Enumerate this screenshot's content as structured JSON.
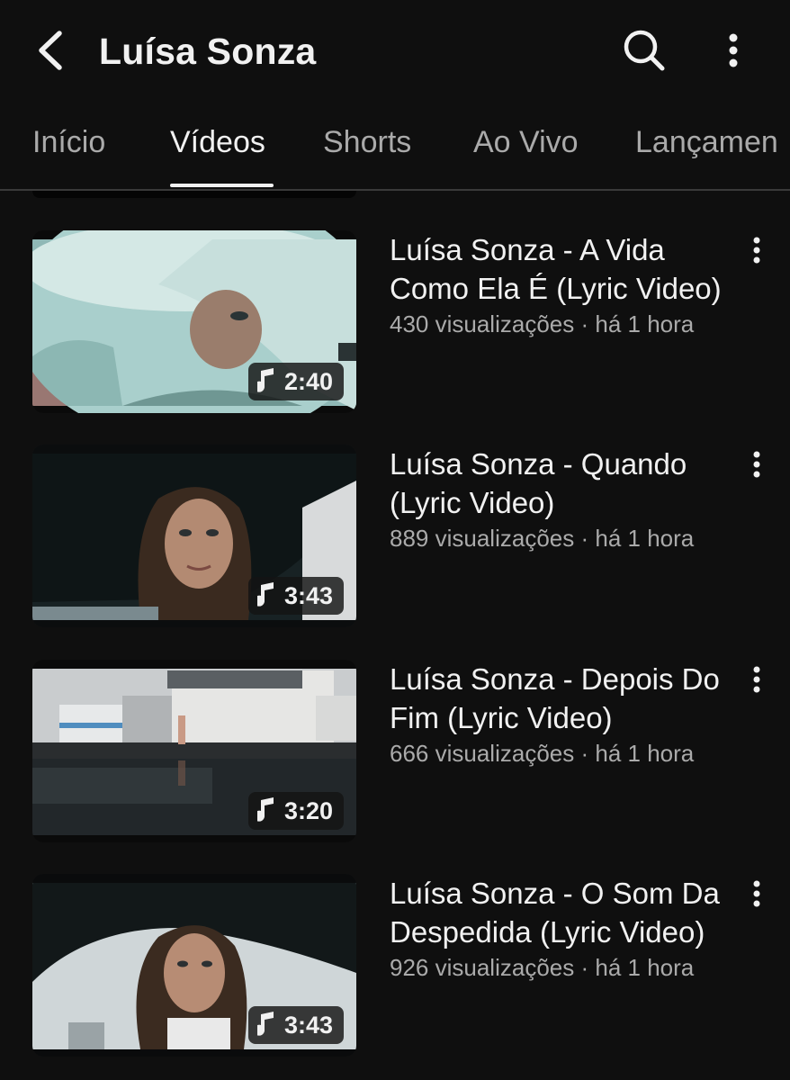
{
  "header": {
    "title": "Luísa Sonza",
    "back_icon": "chevron-left-icon",
    "search_icon": "search-icon",
    "more_icon": "more-vertical-icon"
  },
  "tabs": [
    {
      "label": "Início",
      "active": false
    },
    {
      "label": "Vídeos",
      "active": true
    },
    {
      "label": "Shorts",
      "active": false
    },
    {
      "label": "Ao Vivo",
      "active": false
    },
    {
      "label": "Lançamen",
      "active": false
    }
  ],
  "videos": [
    {
      "title": "Luísa Sonza - A Vida Como Ela É (Lyric Video)",
      "views": "430 visualizações",
      "age": "há 1 hora",
      "duration": "2:40",
      "duration_icon": "music-note-icon"
    },
    {
      "title": "Luísa Sonza - Quando (Lyric Video)",
      "views": "889 visualizações",
      "age": "há 1 hora",
      "duration": "3:43",
      "duration_icon": "music-note-icon"
    },
    {
      "title": "Luísa Sonza - Depois Do Fim (Lyric Video)",
      "views": "666 visualizações",
      "age": "há 1 hora",
      "duration": "3:20",
      "duration_icon": "music-note-icon"
    },
    {
      "title": "Luísa Sonza - O Som Da Despedida (Lyric Video)",
      "views": "926 visualizações",
      "age": "há 1 hora",
      "duration": "3:43",
      "duration_icon": "music-note-icon"
    }
  ],
  "separator": "·",
  "colors": {
    "background": "#0f0f0f",
    "text_primary": "#f1f1f1",
    "text_secondary": "#aaaaaa"
  }
}
